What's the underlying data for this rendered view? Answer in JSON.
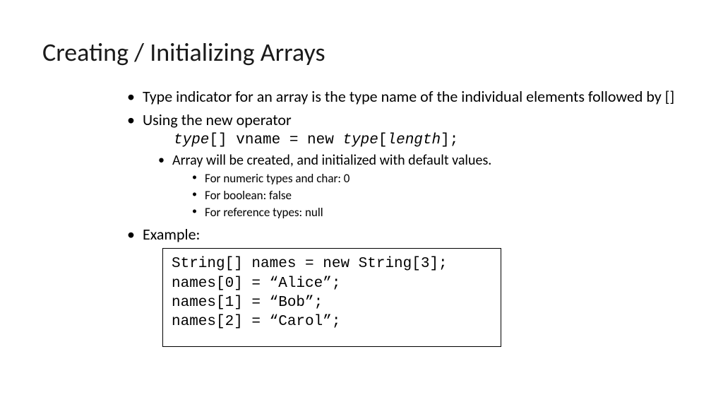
{
  "title": "Creating / Initializing Arrays",
  "bullets": {
    "b1": "Type indicator for an array is the type name of the individual elements followed by []",
    "b2": "Using the new operator",
    "syntax": {
      "type1": "type",
      "brackets": "[] ",
      "vname": "vname",
      "eqnew": " = new ",
      "type2": "type",
      "open": "[",
      "length": "length",
      "close": "];"
    },
    "b2a": "Array will be created, and initialized with default values.",
    "b2a1": "For numeric types and char: 0",
    "b2a2": "For boolean: false",
    "b2a3": "For reference types: null",
    "b3": "Example:"
  },
  "code": "String[] names = new String[3];\nnames[0] = “Alice”;\nnames[1] = “Bob”;\nnames[2] = “Carol”;"
}
